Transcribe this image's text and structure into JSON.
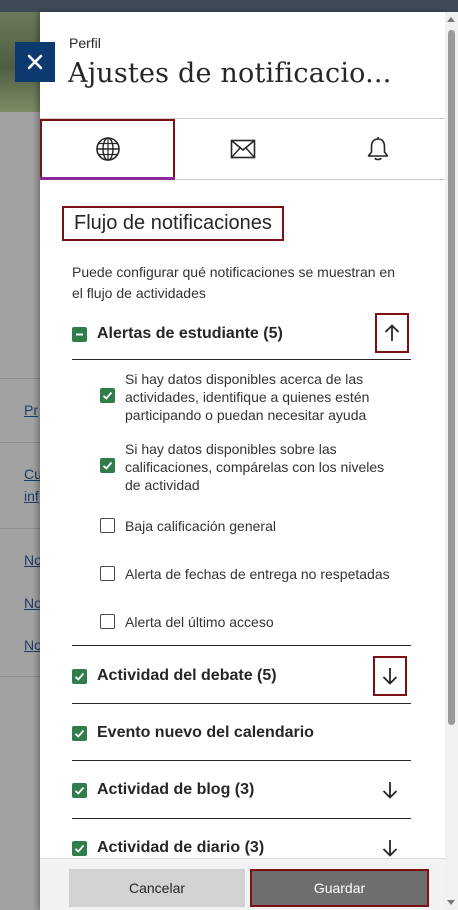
{
  "panel": {
    "eyebrow": "Perfil",
    "title": "Ajustes de notificacio..."
  },
  "background_links": [
    "Pr",
    "Cu",
    "inf",
    "No",
    "No",
    "No"
  ],
  "tabs": [
    {
      "icon": "globe-icon",
      "active": true
    },
    {
      "icon": "envelope-icon",
      "active": false
    },
    {
      "icon": "bell-icon",
      "active": false
    }
  ],
  "section": {
    "title": "Flujo de notificaciones",
    "description": "Puede configurar qué notificaciones se muestran en el flujo de actividades"
  },
  "groups": [
    {
      "label": "Alertas de estudiante (5)",
      "state": "partial",
      "expanded": true,
      "items": [
        {
          "text": "Si hay datos disponibles acerca de las actividades, identifique a quienes estén participando o puedan necesitar ayuda",
          "checked": true
        },
        {
          "text": "Si hay datos disponibles sobre las calificaciones, compárelas con los niveles de actividad",
          "checked": true
        },
        {
          "text": "Baja calificación general",
          "checked": false
        },
        {
          "text": "Alerta de fechas de entrega no respetadas",
          "checked": false
        },
        {
          "text": "Alerta del último acceso",
          "checked": false
        }
      ]
    },
    {
      "label": "Actividad del debate (5)",
      "state": "checked",
      "expanded": false
    },
    {
      "label": "Evento nuevo del calendario",
      "state": "checked",
      "expanded": false
    },
    {
      "label": "Actividad de blog (3)",
      "state": "checked",
      "expanded": false
    },
    {
      "label": "Actividad de diario (3)",
      "state": "checked",
      "expanded": false
    }
  ],
  "footer": {
    "cancel_label": "Cancelar",
    "save_label": "Guardar"
  },
  "colors": {
    "check_green": "#2e7d4b",
    "highlight_border": "#7d1015",
    "close_button": "#0d3a6e",
    "active_tab_underline": "#8a2a9c"
  }
}
